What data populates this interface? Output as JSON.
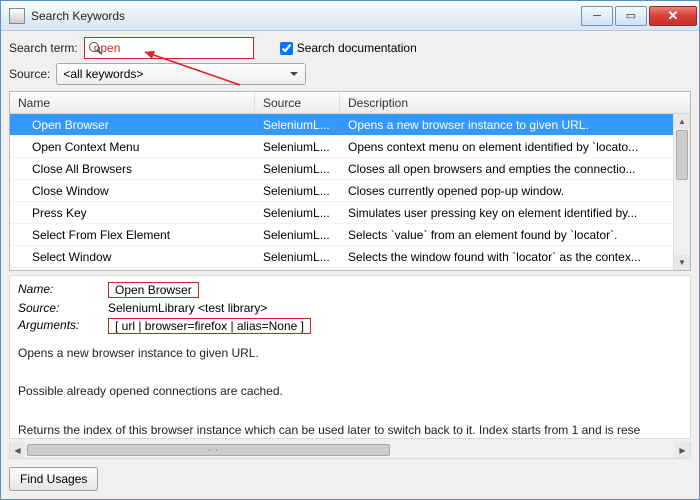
{
  "window": {
    "title": "Search Keywords"
  },
  "search": {
    "label": "Search term:",
    "value": "open",
    "doc_checkbox_label": "Search documentation"
  },
  "source": {
    "label": "Source:",
    "selected": "<all keywords>"
  },
  "columns": {
    "name": "Name",
    "source": "Source",
    "description": "Description"
  },
  "rows": [
    {
      "name": "Open Browser",
      "source": "SeleniumL...",
      "desc": "Opens a new browser instance to given URL."
    },
    {
      "name": "Open Context Menu",
      "source": "SeleniumL...",
      "desc": "Opens context menu on element identified by `locato..."
    },
    {
      "name": "Close All Browsers",
      "source": "SeleniumL...",
      "desc": "Closes all open browsers and empties the connectio..."
    },
    {
      "name": "Close Window",
      "source": "SeleniumL...",
      "desc": "Closes currently opened pop-up window."
    },
    {
      "name": "Press Key",
      "source": "SeleniumL...",
      "desc": "Simulates user pressing key on element identified by..."
    },
    {
      "name": "Select From Flex Element",
      "source": "SeleniumL...",
      "desc": "Selects `value` from an element found by `locator`."
    },
    {
      "name": "Select Window",
      "source": "SeleniumL...",
      "desc": "Selects the window found with `locator` as the contex..."
    }
  ],
  "details": {
    "name_label": "Name:",
    "name_value": "Open Browser",
    "source_label": "Source:",
    "source_value": "SeleniumLibrary <test library>",
    "args_label": "Arguments:",
    "args_value": "[ url | browser=firefox | alias=None ]",
    "doc1": "Opens a new browser instance to given URL.",
    "doc2": "Possible already opened connections are cached.",
    "doc3": "Returns the index of this browser instance which can be used later to switch back to it. Index starts from 1 and is rese"
  },
  "buttons": {
    "find_usages": "Find Usages"
  }
}
